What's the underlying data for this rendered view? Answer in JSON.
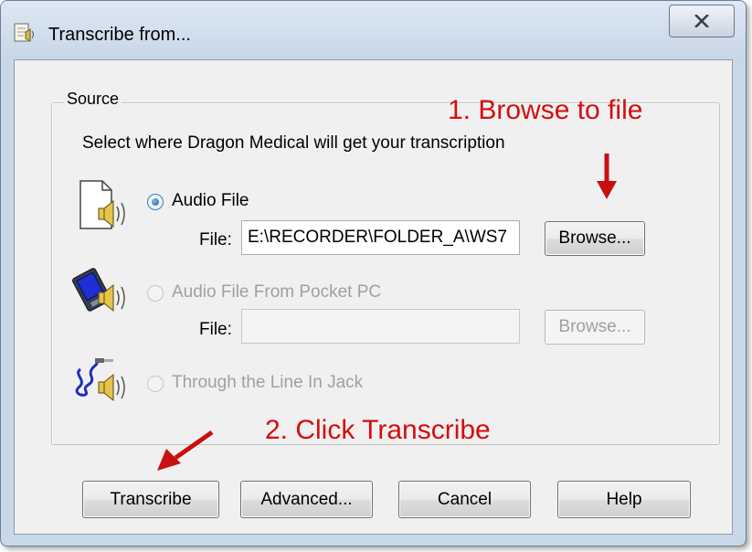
{
  "window": {
    "title": "Transcribe from...",
    "close_glyph": "X",
    "app_icon": "dragon-app-icon"
  },
  "source_group": {
    "label": "Source",
    "description": "Select where Dragon Medical will get your transcription"
  },
  "options": [
    {
      "label": "Audio File",
      "selected": true,
      "enabled": true,
      "icon": "audio-file-icon",
      "file_label": "File:",
      "file_value": "E:\\RECORDER\\FOLDER_A\\WS7",
      "browse_label": "Browse..."
    },
    {
      "label": "Audio File From Pocket PC",
      "selected": false,
      "enabled": false,
      "icon": "pocket-pc-icon",
      "file_label": "File:",
      "file_value": "",
      "browse_label": "Browse..."
    },
    {
      "label": "Through the Line In Jack",
      "selected": false,
      "enabled": false,
      "icon": "line-in-jack-icon"
    }
  ],
  "annotations": {
    "step1": "1.  Browse to file",
    "step2": "2.  Click Transcribe",
    "color": "#d40e0e"
  },
  "buttons": {
    "transcribe": "Transcribe",
    "advanced": "Advanced...",
    "cancel": "Cancel",
    "help": "Help"
  }
}
